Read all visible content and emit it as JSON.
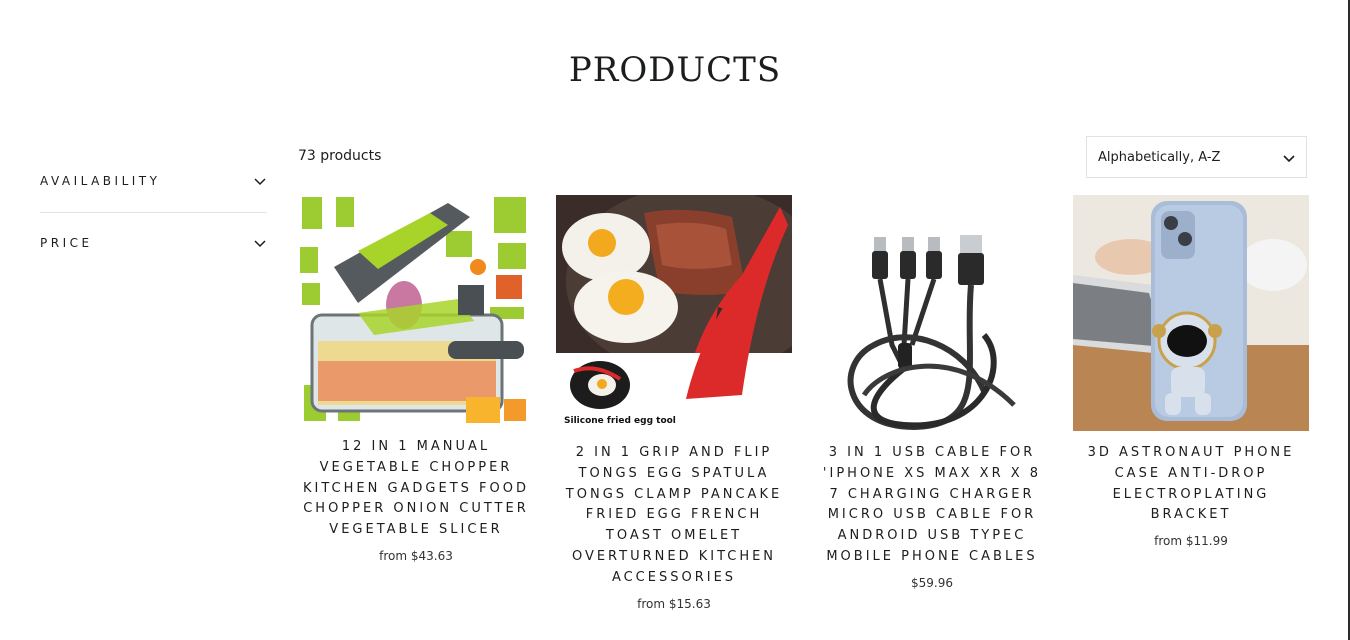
{
  "page": {
    "title": "PRODUCTS"
  },
  "filters": [
    {
      "label": "AVAILABILITY"
    },
    {
      "label": "PRICE"
    }
  ],
  "toolbar": {
    "product_count": "73 products",
    "sort_selected": "Alphabetically, A-Z"
  },
  "products": [
    {
      "name": "12 IN 1 MANUAL VEGETABLE CHOPPER KITCHEN GADGETS FOOD CHOPPER ONION CUTTER VEGETABLE SLICER",
      "price": "from $43.63"
    },
    {
      "name": "2 IN 1 GRIP AND FLIP TONGS EGG SPATULA TONGS CLAMP PANCAKE FRIED EGG FRENCH TOAST OMELET OVERTURNED KITCHEN ACCESSORIES",
      "price": "from $15.63",
      "image_caption": "Silicone fried egg tool"
    },
    {
      "name": "3 IN 1 USB CABLE FOR 'IPHONE XS MAX XR X 8 7 CHARGING CHARGER MICRO USB CABLE FOR ANDROID USB TYPEC MOBILE PHONE CABLES",
      "price": "$59.96"
    },
    {
      "name": "3D ASTRONAUT PHONE CASE ANTI-DROP ELECTROPLATING BRACKET",
      "price": "from $11.99"
    }
  ]
}
